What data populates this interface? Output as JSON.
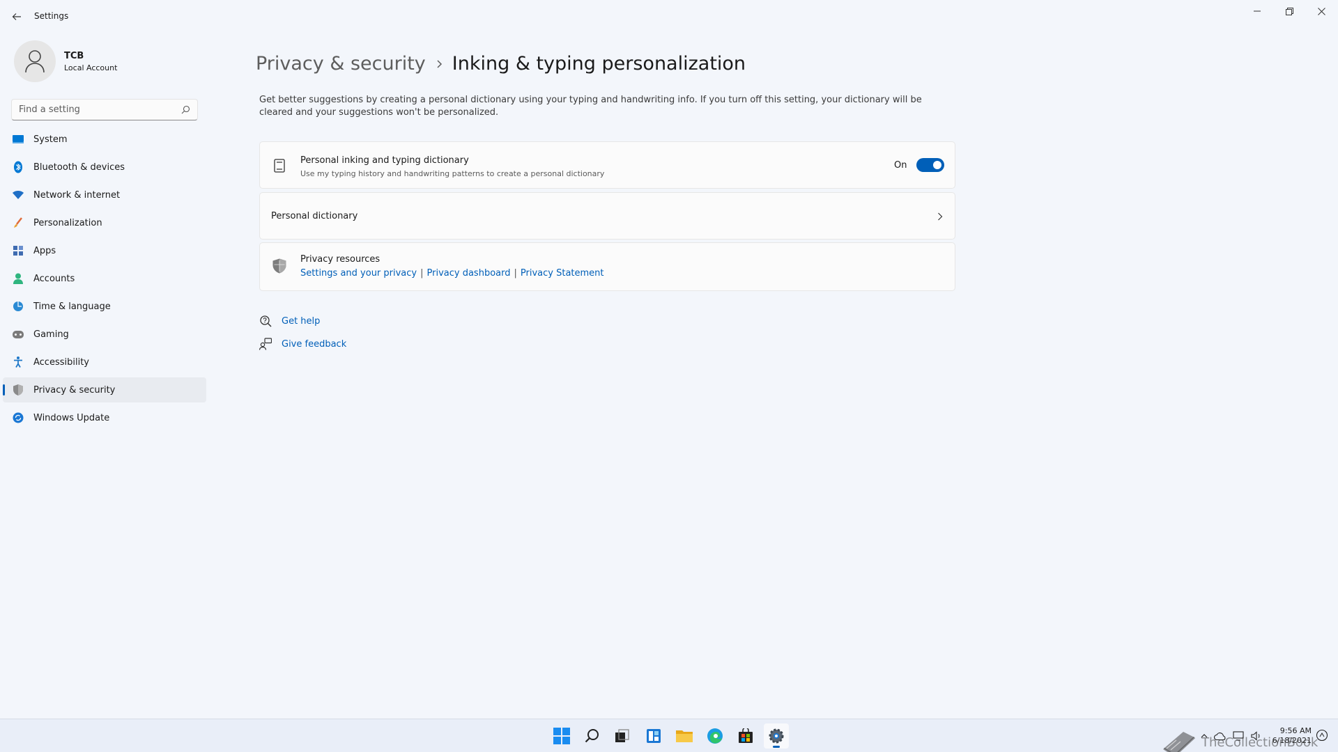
{
  "app": {
    "title": "Settings"
  },
  "profile": {
    "name": "TCB",
    "account_type": "Local Account"
  },
  "search": {
    "placeholder": "Find a setting"
  },
  "sidebar": {
    "items": [
      {
        "label": "System",
        "icon": "monitor-icon",
        "color": "#0078d4"
      },
      {
        "label": "Bluetooth & devices",
        "icon": "bluetooth-icon",
        "color": "#0078d4"
      },
      {
        "label": "Network & internet",
        "icon": "wifi-icon",
        "color": "#1f6fc6"
      },
      {
        "label": "Personalization",
        "icon": "brush-icon",
        "color": "#e06c3a"
      },
      {
        "label": "Apps",
        "icon": "apps-icon",
        "color": "#3f6cb1"
      },
      {
        "label": "Accounts",
        "icon": "person-icon",
        "color": "#2fb57f"
      },
      {
        "label": "Time & language",
        "icon": "globe-icon",
        "color": "#2a8ad4"
      },
      {
        "label": "Gaming",
        "icon": "gamepad-icon",
        "color": "#7a7a7a"
      },
      {
        "label": "Accessibility",
        "icon": "accessibility-icon",
        "color": "#1e78c8"
      },
      {
        "label": "Privacy & security",
        "icon": "shield-icon",
        "color": "#8a8a8a",
        "active": true
      },
      {
        "label": "Windows Update",
        "icon": "update-icon",
        "color": "#1a77d4"
      }
    ]
  },
  "breadcrumb": {
    "parent": "Privacy & security",
    "current": "Inking & typing personalization"
  },
  "description": "Get better suggestions by creating a personal dictionary using your typing and handwriting info. If you turn off this setting, your dictionary will be cleared and your suggestions won't be personalized.",
  "dictionary_setting": {
    "title": "Personal inking and typing dictionary",
    "subtitle": "Use my typing history and handwriting patterns to create a personal dictionary",
    "state_label": "On",
    "enabled": true
  },
  "personal_dictionary": {
    "title": "Personal dictionary"
  },
  "privacy_resources": {
    "title": "Privacy resources",
    "links": [
      "Settings and your privacy",
      "Privacy dashboard",
      "Privacy Statement"
    ],
    "separator": "|"
  },
  "help": {
    "get_help": "Get help",
    "give_feedback": "Give feedback"
  },
  "taskbar": {
    "clock_time": "9:56 AM",
    "clock_date": "6/18/2021",
    "watermark": "TheCollectionBook"
  },
  "colors": {
    "accent": "#005fb8",
    "link": "#005fb8"
  }
}
